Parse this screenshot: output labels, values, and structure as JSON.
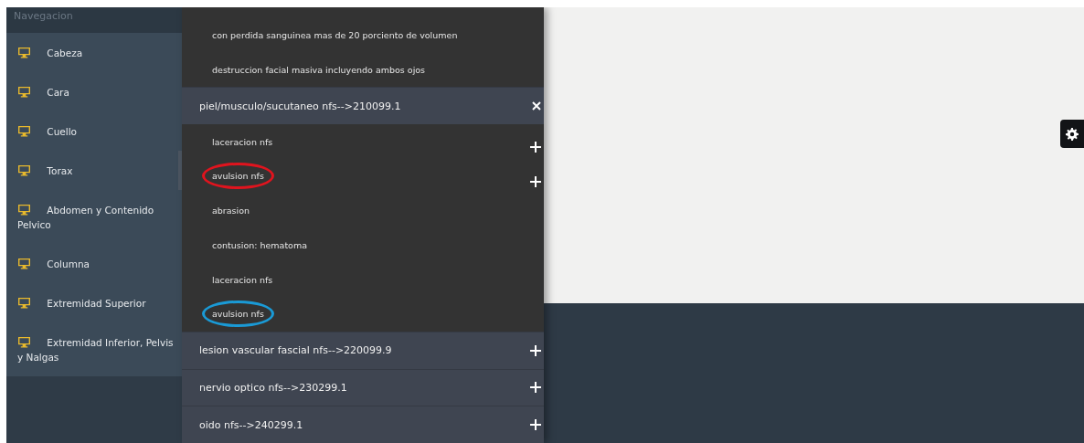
{
  "sidebar": {
    "header": "Navegacion",
    "items": [
      {
        "label": "Cabeza",
        "selected": false
      },
      {
        "label": "Cara",
        "selected": false
      },
      {
        "label": "Cuello",
        "selected": false
      },
      {
        "label": "Torax",
        "selected": true
      },
      {
        "label": "Abdomen y Contenido Pelvico",
        "selected": false
      },
      {
        "label": "Columna",
        "selected": false
      },
      {
        "label": "Extremidad Superior",
        "selected": false
      },
      {
        "label": "Extremidad Inferior, Pelvis y Nalgas",
        "selected": false
      }
    ]
  },
  "panel": {
    "items": [
      {
        "kind": "option",
        "label": "con perdida sanguinea mas de 20 porciento de volumen",
        "add": false
      },
      {
        "kind": "option",
        "label": "destruccion facial masiva incluyendo ambos ojos",
        "add": false
      },
      {
        "kind": "category",
        "label": "piel/musculo/sucutaneo nfs-->210099.1",
        "expanded": true
      },
      {
        "kind": "option",
        "label": "laceracion nfs",
        "add": true
      },
      {
        "kind": "option",
        "label": "avulsion nfs",
        "add": true,
        "color": "#e0141e"
      },
      {
        "kind": "option",
        "label": "abrasion",
        "add": false
      },
      {
        "kind": "option",
        "label": "contusion: hematoma",
        "add": false
      },
      {
        "kind": "option",
        "label": "laceracion nfs",
        "add": false
      },
      {
        "kind": "option",
        "label": "avulsion nfs",
        "add": false,
        "color": "#1a9ad6"
      },
      {
        "kind": "category",
        "label": "lesion vascular fascial nfs-->220099.9",
        "expanded": false
      },
      {
        "kind": "category",
        "label": "nervio optico nfs-->230299.1",
        "expanded": false
      },
      {
        "kind": "category",
        "label": "oido nfs-->240299.1",
        "expanded": false
      }
    ]
  }
}
